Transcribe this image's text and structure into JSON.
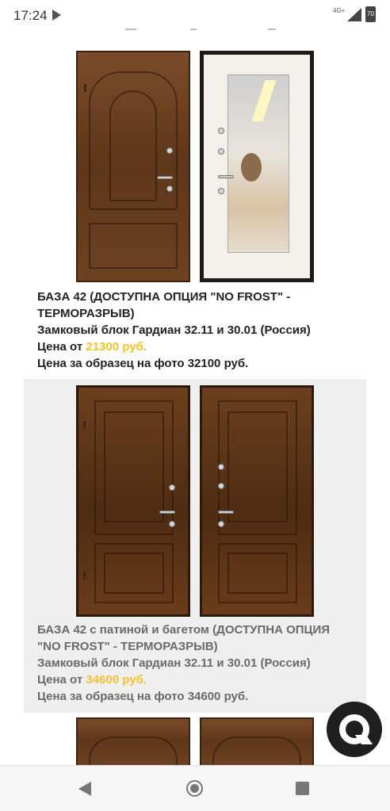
{
  "status_bar": {
    "time": "17:24",
    "network": "4G+",
    "battery": "70"
  },
  "products": [
    {
      "name": "БАЗА 42 (ДОСТУПНА ОПЦИЯ \"NO FROST\" - ТЕРМОРАЗРЫВ)",
      "lock": "Замковый блок Гардиан 32.11 и 30.01 (Россия)",
      "price_prefix": "Цена от ",
      "price": "21300 руб.",
      "sample_price": "Цена за образец на фото 32100 руб."
    },
    {
      "name": "БАЗА 42 с патиной и багетом (ДОСТУПНА ОПЦИЯ \"NO FROST\" - ТЕРМОРАЗРЫВ)",
      "lock": "Замковый блок Гардиан 32.11 и 30.01 (Россия)",
      "price_prefix": "Цена от ",
      "price": "34600 руб.",
      "sample_price": "Цена за образец на фото 34600 руб."
    }
  ],
  "colors": {
    "price_accent": "#f6c22c",
    "section_bg": "#efefef",
    "chat_button": "#1f1f1f"
  },
  "icons": {
    "chat": "chat-bubble-icon",
    "back": "back-triangle-icon",
    "home": "home-circle-icon",
    "recents": "recents-square-icon"
  }
}
